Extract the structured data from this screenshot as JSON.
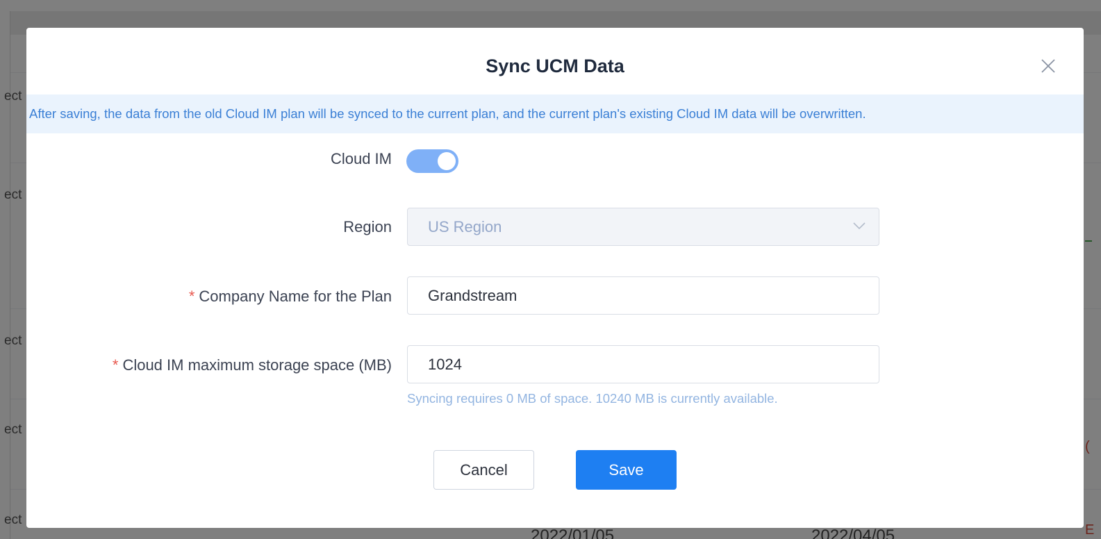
{
  "background": {
    "row_text": "ect",
    "dates": [
      "2022/01/05",
      "2022/04/05"
    ]
  },
  "modal": {
    "title": "Sync UCM Data",
    "close_icon": "close-icon",
    "info_banner": "After saving, the data from the old Cloud IM plan will be synced to the current plan, and the current plan's existing Cloud IM data will be overwritten.",
    "fields": {
      "cloud_im": {
        "label": "Cloud IM",
        "enabled": true
      },
      "region": {
        "label": "Region",
        "value": "US Region",
        "disabled": true
      },
      "company_name": {
        "label": "Company Name for the Plan",
        "required": true,
        "value": "Grandstream"
      },
      "storage": {
        "label": "Cloud IM maximum storage space (MB)",
        "required": true,
        "value": "1024",
        "hint": "Syncing requires 0 MB of space. 10240 MB is currently available."
      }
    },
    "buttons": {
      "cancel": "Cancel",
      "save": "Save"
    },
    "colors": {
      "primary": "#1e7ff2",
      "toggle_on": "#7fb0f7",
      "banner_bg": "#eaf3fd",
      "required": "#e8584e"
    }
  }
}
